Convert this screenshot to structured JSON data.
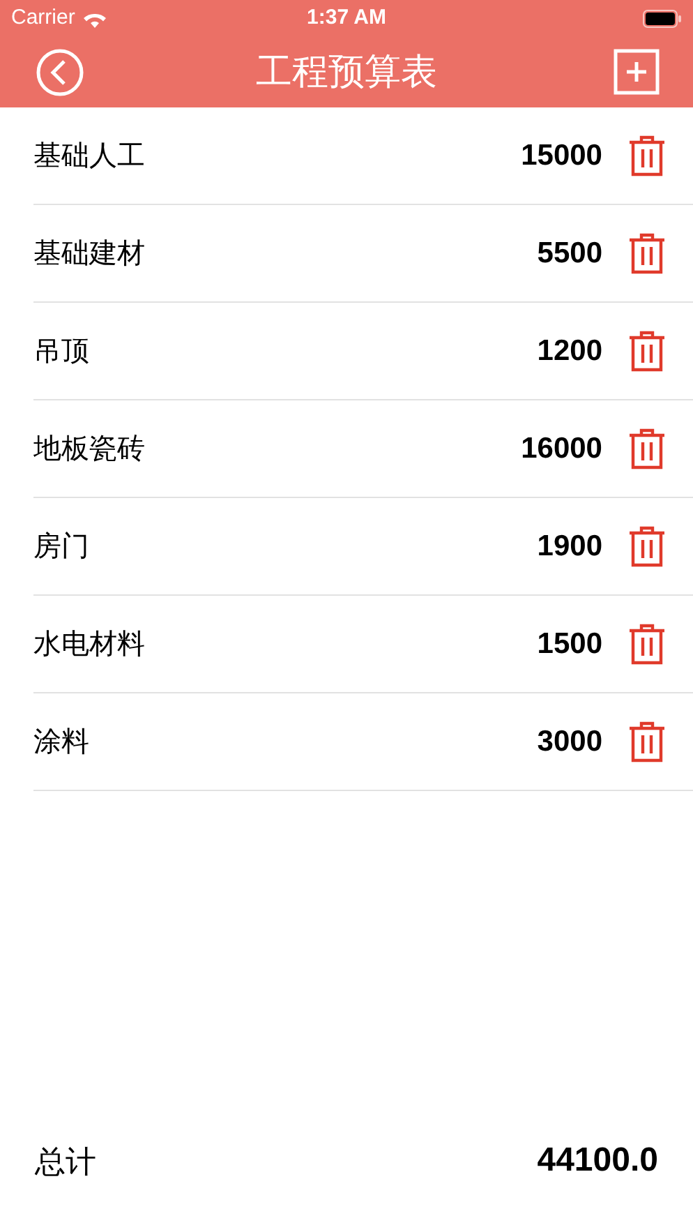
{
  "status_bar": {
    "carrier": "Carrier",
    "time": "1:37 AM"
  },
  "nav": {
    "title": "工程预算表"
  },
  "items": [
    {
      "name": "基础人工",
      "amount": "15000"
    },
    {
      "name": "基础建材",
      "amount": "5500"
    },
    {
      "name": "吊顶",
      "amount": "1200"
    },
    {
      "name": "地板瓷砖",
      "amount": "16000"
    },
    {
      "name": "房门",
      "amount": "1900"
    },
    {
      "name": "水电材料",
      "amount": "1500"
    },
    {
      "name": "涂料",
      "amount": "3000"
    }
  ],
  "total": {
    "label": "总计",
    "value": "44100.0"
  }
}
